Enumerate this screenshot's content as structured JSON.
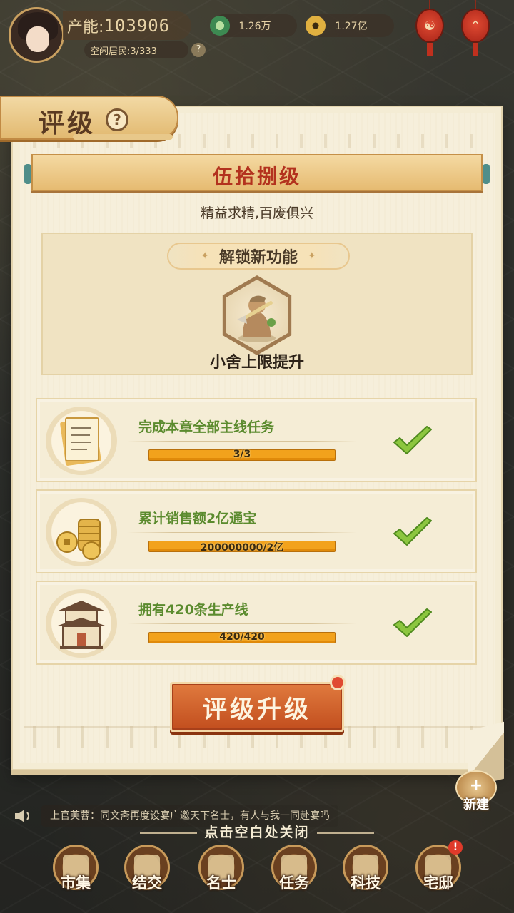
{
  "hud": {
    "capacity_label": "产能:",
    "capacity_value": "103906",
    "idle_residents": "空闲居民:3/333",
    "help_mark": "?",
    "resources": [
      {
        "name": "jade-coin",
        "value": "1.26万",
        "color": "#3d8a52"
      },
      {
        "name": "copper-coin",
        "value": "1.27亿",
        "color": "#e0b040"
      }
    ],
    "lantern_glyphs": [
      "☯",
      "⌃"
    ]
  },
  "panel": {
    "title": "评级",
    "help_mark": "?",
    "rank_banner": "伍拾捌级",
    "motto": "精益求精,百废俱兴",
    "unlock": {
      "heading": "解锁新功能",
      "sparkle": "✦",
      "feature_label": "小舍上限提升",
      "feature_icon": "worker-with-hoe-icon"
    },
    "tasks": [
      {
        "name": "完成本章全部主线任务",
        "progress": "3/3",
        "icon": "scroll-book-icon",
        "done": true
      },
      {
        "name": "累计销售额2亿通宝",
        "progress": "200000000/2亿",
        "icon": "coin-stack-icon",
        "done": true
      },
      {
        "name": "拥有420条生产线",
        "progress": "420/420",
        "icon": "building-icon",
        "done": true
      }
    ],
    "upgrade_button": "评级升级"
  },
  "bottom": {
    "broadcast": "上官芙蓉：同文斋再度设宴广邀天下名士，有人与我一同赴宴吗",
    "close_hint": "点击空白处关闭",
    "new_build_label": "新建",
    "new_build_plus": "+",
    "nav": [
      {
        "label": "市集"
      },
      {
        "label": "结交"
      },
      {
        "label": "名士"
      },
      {
        "label": "任务"
      },
      {
        "label": "科技"
      },
      {
        "label": "宅邸",
        "badge": "!"
      }
    ]
  },
  "colors": {
    "accent_red": "#b3321e",
    "task_green": "#5b8b2e",
    "progress_orange": "#f2a21c",
    "button_orange": "#c24e1e"
  }
}
